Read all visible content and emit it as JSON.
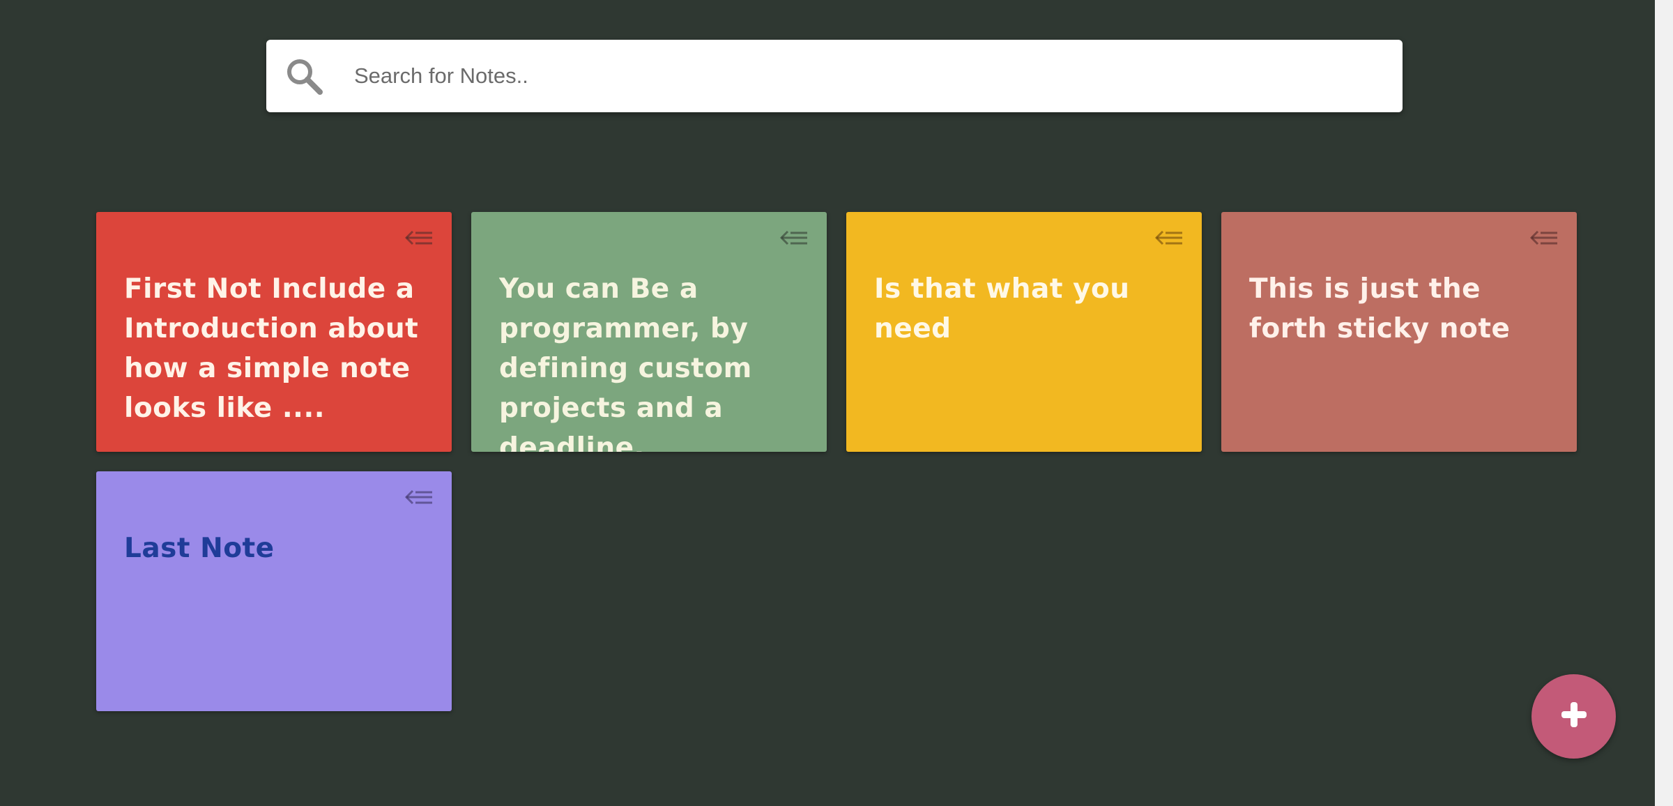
{
  "search": {
    "placeholder": "Search for Notes..",
    "value": ""
  },
  "notes": [
    {
      "text": "First Not Include a Introduction about how a simple note looks like ....",
      "bg_color": "#dc453b",
      "text_color": "#fff3e8",
      "menu_icon": "menu-collapse-icon"
    },
    {
      "text": "You can Be a programmer, by defining custom projects and a deadline, everything",
      "bg_color": "#7ca67e",
      "text_color": "#f6f4df",
      "menu_icon": "menu-collapse-icon"
    },
    {
      "text": "Is that what you need",
      "bg_color": "#f2b821",
      "text_color": "#fff8e6",
      "menu_icon": "menu-collapse-icon"
    },
    {
      "text": "This is just the forth sticky note",
      "bg_color": "#bd6e62",
      "text_color": "#fff1ea",
      "menu_icon": "menu-collapse-icon"
    },
    {
      "text": "Last Note",
      "bg_color": "#9a8ae9",
      "text_color": "#1f3c98",
      "menu_icon": "menu-collapse-icon"
    }
  ],
  "add_button": {
    "icon": "plus-icon",
    "color": "#c35a78"
  },
  "colors": {
    "background": "#2f3832"
  }
}
